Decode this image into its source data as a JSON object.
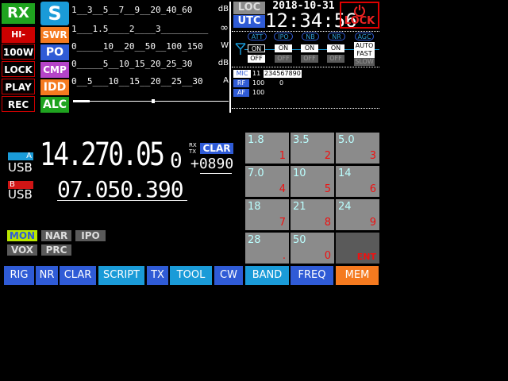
{
  "status": {
    "rx": "RX",
    "hi_swr": "HI-SWR",
    "power": "100W",
    "lock": "LOCK",
    "play": "PLAY",
    "rec": "REC"
  },
  "meters": {
    "s": "S",
    "swr": "SWR",
    "po": "PO",
    "cmp": "CMP",
    "idd": "IDD",
    "alc": "ALC",
    "s_scale": "1__3__5__7__9__20_40_60",
    "s_unit": "dB",
    "swr_scale": "1___1.5____2____3_________",
    "swr_unit": "∞",
    "po_scale": "0_____10__20__50__100_150",
    "po_unit": "W",
    "cmp_scale": "0_____5__10_15_20_25_30",
    "cmp_unit": "dB",
    "idd_scale": "0__5___10__15__20__25__30",
    "idd_unit": "A",
    "alc_level": 0.7
  },
  "clock": {
    "loc": "LOC",
    "utc": "UTC",
    "date": "2018-10-31",
    "time": "12:34:56"
  },
  "lock_btn": {
    "label": "LOCK",
    "icon": "power-icon"
  },
  "func_row": {
    "att": "ATT",
    "ipo": "IPO",
    "nb": "NB",
    "nr": "NR",
    "agc": "AGC",
    "on": "ON",
    "off": "OFF",
    "auto": "AUTO",
    "fast": "FAST",
    "slow": "SLOW"
  },
  "levels": {
    "mic": "MIC",
    "mic_val": "11",
    "mic_scale": "234567890",
    "rf": "RF",
    "rf_val": "100",
    "rf_mid": "0",
    "af": "AF",
    "af_val": "100"
  },
  "vfo_a": {
    "badge": "A",
    "mode": "USB",
    "freq": "14.270.05",
    "freq_small": "0",
    "rx": "RX",
    "tx": "TX",
    "clar": "CLAR",
    "offset": "+0890"
  },
  "vfo_b": {
    "badge": "B",
    "mode": "USB",
    "freq": "07.050.390"
  },
  "tags": {
    "mon": "MON",
    "nar": "NAR",
    "ipo": "IPO",
    "vox": "VOX",
    "prc": "PRC"
  },
  "keypad": [
    {
      "f": "1.8",
      "d": "1"
    },
    {
      "f": "3.5",
      "d": "2"
    },
    {
      "f": "5.0",
      "d": "3"
    },
    {
      "f": "7.0",
      "d": "4"
    },
    {
      "f": "10",
      "d": "5"
    },
    {
      "f": "14",
      "d": "6"
    },
    {
      "f": "18",
      "d": "7"
    },
    {
      "f": "21",
      "d": "8"
    },
    {
      "f": "24",
      "d": "9"
    },
    {
      "f": "28",
      "d": "."
    },
    {
      "f": "50",
      "d": "0"
    },
    {
      "f": "",
      "d": "ENT"
    }
  ],
  "buttons": [
    "RIG",
    "NR",
    "CLAR",
    "SCRIPT",
    "TX",
    "TOOL",
    "CW",
    "BAND",
    "FREQ",
    "MEM"
  ],
  "colors": {
    "accent": "#2f5bd6",
    "cyan": "#1a9bd8",
    "orange": "#f57a1f",
    "red": "#c00000",
    "green": "#1fa31f"
  }
}
